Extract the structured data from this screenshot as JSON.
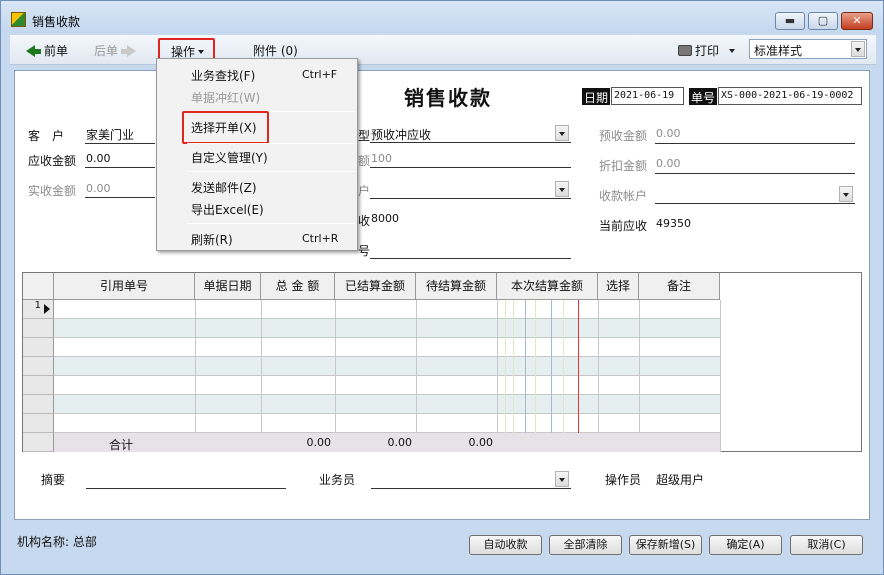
{
  "window": {
    "title": "销售收款"
  },
  "toolbar": {
    "prev": "前单",
    "next": "后单",
    "ops": "操作",
    "attach": "附件 (0)",
    "print": "打印",
    "style": "标准样式"
  },
  "doc": {
    "title": "销售收款",
    "date_tag": "日期",
    "date": "2021-06-19",
    "no_tag": "单号",
    "number": "XS-000-2021-06-19-0002"
  },
  "form": {
    "customer_label": "客　户",
    "customer": "家美门业",
    "receivable_label": "应收金额",
    "receivable": "0.00",
    "actual_label": "实收金额",
    "actual": "0.00",
    "type_label": "型",
    "type": "预收冲应收",
    "m2_label": "额",
    "m2": "100",
    "m3_label": "户",
    "m4_label": "收",
    "m4": "8000",
    "m5_label": "号",
    "prepay_label": "预收金额",
    "prepay": "0.00",
    "discount_label": "折扣金额",
    "discount": "0.00",
    "account_label": "收款帐户",
    "current_label": "当前应收",
    "current": "49350"
  },
  "grid": {
    "headers": [
      "引用单号",
      "单据日期",
      "总 金 额",
      "已结算金额",
      "待结算金额",
      "本次结算金额",
      "选择",
      "备注"
    ],
    "first_row": "1",
    "sum_label": "合计",
    "sum_total": "0.00",
    "sum_settled": "0.00",
    "sum_pending": "0.00"
  },
  "bottom": {
    "summary_label": "摘要",
    "salesman_label": "业务员",
    "operator_label": "操作员",
    "operator": "超级用户"
  },
  "menu": {
    "items": [
      {
        "label": "业务查找(F)",
        "shortcut": "Ctrl+F"
      },
      {
        "label": "单据冲红(W)",
        "shortcut": ""
      },
      {
        "label": "选择开单(X)",
        "shortcut": ""
      },
      {
        "label": "自定义管理(Y)",
        "shortcut": ""
      },
      {
        "label": "发送邮件(Z)",
        "shortcut": ""
      },
      {
        "label": "导出Excel(E)",
        "shortcut": ""
      },
      {
        "label": "刷新(R)",
        "shortcut": "Ctrl+R"
      }
    ]
  },
  "footer": {
    "org": "机构名称: 总部",
    "auto": "自动收款",
    "clear": "全部清除",
    "save_new": "保存新增(S)",
    "ok": "确定(A)",
    "cancel": "取消(C)"
  },
  "colors": {
    "highlight": "#e0261f",
    "window_bg": "#c6d9ee"
  }
}
